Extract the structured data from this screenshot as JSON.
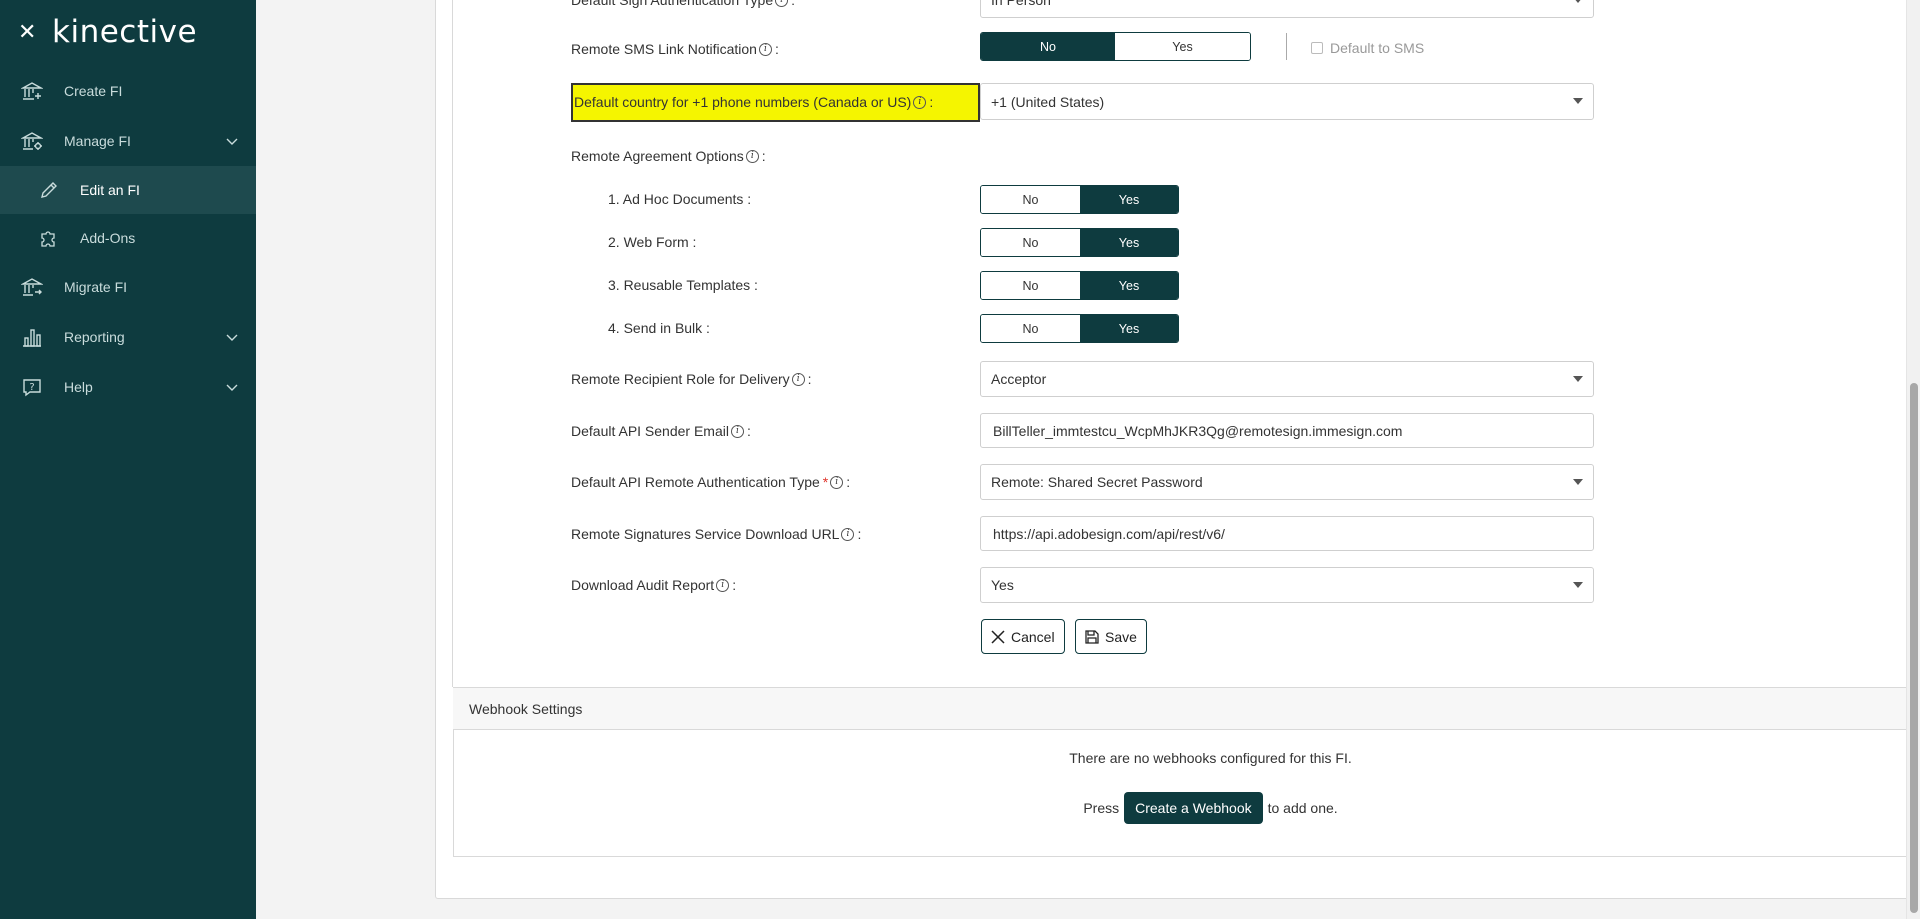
{
  "sidebar": {
    "close_icon": "close-icon",
    "logo": "kinective",
    "items": [
      {
        "label": "Create FI",
        "icon": "bank-plus-icon"
      },
      {
        "label": "Manage FI",
        "icon": "bank-gear-icon"
      },
      {
        "label": "Edit an FI",
        "icon": "pencil-icon"
      },
      {
        "label": "Add-Ons",
        "icon": "puzzle-icon"
      },
      {
        "label": "Migrate FI",
        "icon": "bank-arrow-icon"
      },
      {
        "label": "Reporting",
        "icon": "bar-chart-icon"
      },
      {
        "label": "Help",
        "icon": "help-bubble-icon"
      }
    ]
  },
  "form": {
    "top_partial_label": "Default Sign Authentication Type",
    "top_partial_value": "In Person",
    "sms_link_label": "Remote SMS Link Notification",
    "sms_no": "No",
    "sms_yes": "Yes",
    "default_to_sms": "Default to SMS",
    "country_label": "Default country for +1 phone numbers (Canada or US)",
    "country_value": "+1 (United States)",
    "agreement_label": "Remote Agreement Options",
    "agreement_options": [
      {
        "label": "1. Ad Hoc Documents :",
        "no": "No",
        "yes": "Yes"
      },
      {
        "label": "2. Web Form :",
        "no": "No",
        "yes": "Yes"
      },
      {
        "label": "3. Reusable Templates :",
        "no": "No",
        "yes": "Yes"
      },
      {
        "label": "4. Send in Bulk :",
        "no": "No",
        "yes": "Yes"
      }
    ],
    "recipient_role_label": "Remote Recipient Role for Delivery",
    "recipient_role_value": "Acceptor",
    "api_email_label": "Default API Sender Email",
    "api_email_value": "BillTeller_immtestcu_WcpMhJKR3Qg@remotesign.immesign.com",
    "api_auth_label": "Default API Remote Authentication Type",
    "api_auth_required": "*",
    "api_auth_value": "Remote: Shared Secret Password",
    "download_url_label": "Remote Signatures Service Download URL",
    "download_url_value": "https://api.adobesign.com/api/rest/v6/",
    "audit_label": "Download Audit Report",
    "audit_value": "Yes",
    "colon": ":",
    "cancel": "Cancel",
    "save": "Save"
  },
  "webhooks": {
    "title": "Webhook Settings",
    "empty_text": "There are no webhooks configured for this FI.",
    "press": "Press",
    "create_button": "Create a Webhook",
    "to_add": "to add one."
  },
  "colors": {
    "sidebar_bg": "#0e3b3f",
    "highlight": "#f5f500",
    "accent": "#0e3b3f"
  }
}
